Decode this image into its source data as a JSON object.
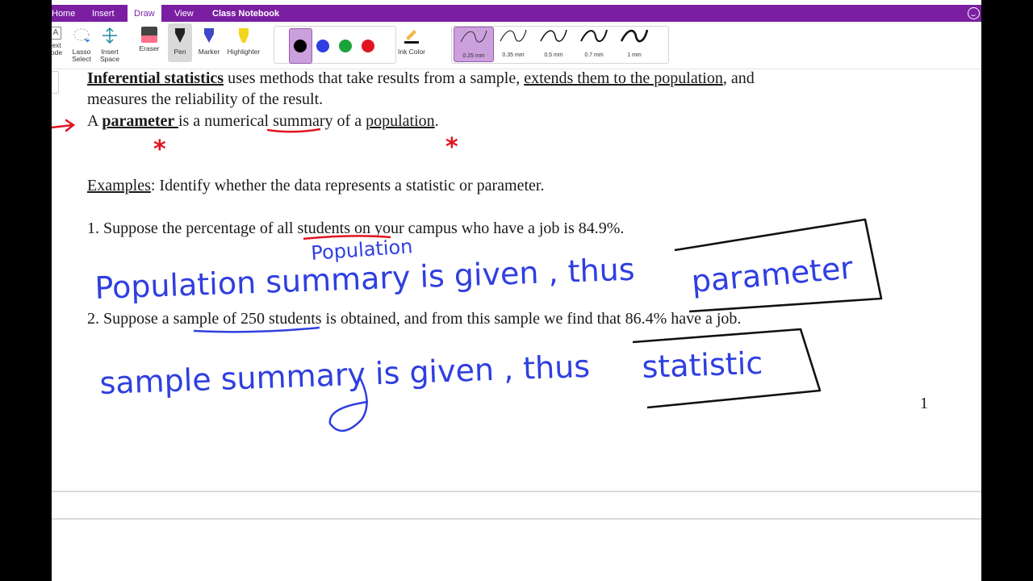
{
  "tabs": [
    "Home",
    "Insert",
    "Draw",
    "View",
    "Class Notebook"
  ],
  "active_tab": "Draw",
  "ribbon": {
    "text_mode": [
      "ext",
      "ode"
    ],
    "lasso": [
      "Lasso",
      "Select"
    ],
    "insert_space": [
      "Insert",
      "Space"
    ],
    "eraser": "Eraser",
    "pen": "Pen",
    "marker": "Marker",
    "highlighter": "Highlighter",
    "ink_color": "Ink Color",
    "thickness": [
      "0.25 mm",
      "0.35 mm",
      "0.5 mm",
      "0.7 mm",
      "1 mm"
    ],
    "selected_thickness": "0.25 mm",
    "colors": [
      "#000000",
      "#2f3fe0",
      "#1aa33a",
      "#e0141f"
    ],
    "selected_color": "#000000"
  },
  "content": {
    "p1_term": "Inferential statistics",
    "p1_a": " uses methods that take results from a sample, ",
    "p1_u": "extends them to the population",
    "p1_b": ", and",
    "p1_line2": "measures the reliability of the result.",
    "p2_a": "A ",
    "p2_term": "parameter ",
    "p2_b": "is a numerical summary of a ",
    "p2_u": "population",
    "p2_c": ".",
    "ex_label": "Examples",
    "ex_text": ": Identify whether the data represents a statistic or parameter.",
    "q1": "1. Suppose the percentage of all students on your campus who have a job is 84.9%.",
    "q2": "2. Suppose a sample of 250 students is obtained, and from this sample we find that 86.4% have a job.",
    "page_number": "1"
  },
  "ink": {
    "above_q1": "Population",
    "answer1_a": "Population summary is given , thus",
    "answer1_b": "parameter",
    "answer2_a": "sample summary is given , thus",
    "answer2_b": "statistic",
    "stars": [
      "*",
      "*"
    ]
  },
  "colors": {
    "accent": "#7a1fa2",
    "ink_blue": "#2f3fe0",
    "ink_red": "#e0141f"
  }
}
